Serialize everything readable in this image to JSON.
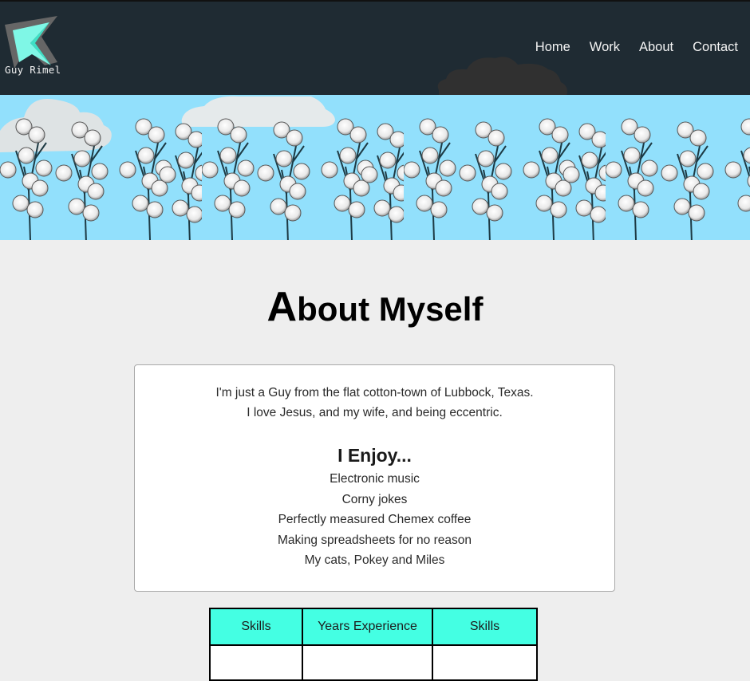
{
  "header": {
    "logo_text": "Guy Rimel",
    "logo_icon": "arrow-cursor-logo",
    "nav": [
      {
        "label": "Home"
      },
      {
        "label": "Work"
      },
      {
        "label": "About"
      },
      {
        "label": "Contact"
      }
    ],
    "colors": {
      "header_bg": "#1f2b33",
      "accent": "#44ffe3",
      "sky": "#92e0fc"
    }
  },
  "banner": {
    "description": "cotton plants under sky with clouds"
  },
  "main": {
    "title_initial": "A",
    "title_rest": "bout Myself",
    "intro_lines": [
      "I'm just a Guy from the flat cotton-town of Lubbock, Texas.",
      "I love Jesus, and my wife, and being eccentric."
    ],
    "enjoy_heading": "I Enjoy...",
    "enjoy_items": [
      "Electronic music",
      "Corny jokes",
      "Perfectly measured Chemex coffee",
      "Making spreadsheets for no reason",
      "My cats, Pokey and Miles"
    ],
    "skills_table": {
      "headers": [
        "Skills",
        "Years Experience",
        "Skills"
      ]
    }
  }
}
